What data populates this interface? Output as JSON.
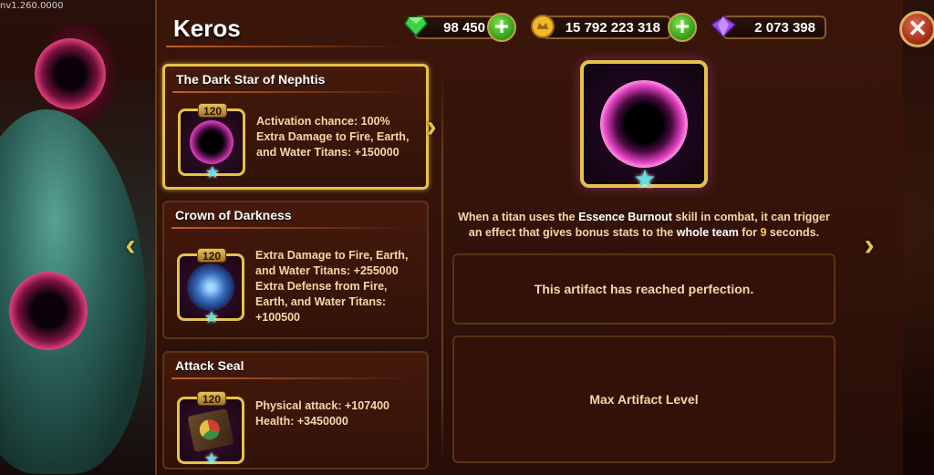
{
  "version": "nv1.260.0000",
  "hero_name": "Keros",
  "resources": {
    "emeralds": "98 450",
    "gold": "15 792 223 318",
    "crystals": "2 073 398"
  },
  "artifacts": [
    {
      "name": "The Dark Star of Nephtis",
      "level": "120",
      "description": "Activation chance: 100%\nExtra Damage to Fire, Earth,\nand Water Titans: +150000"
    },
    {
      "name": "Crown of Darkness",
      "level": "120",
      "description": "Extra Damage to Fire, Earth,\nand Water Titans: +255000\nExtra Defense from Fire,\nEarth, and Water Titans:\n+100500"
    },
    {
      "name": "Attack Seal",
      "level": "120",
      "description": "Physical attack: +107400\nHealth: +3450000"
    }
  ],
  "detail": {
    "desc_1": "When a titan uses the",
    "desc_hl1": "Essence Burnout",
    "desc_2": "skill in combat, it can trigger an effect that gives bonus stats to the",
    "desc_hl2": "whole team",
    "desc_3": "for",
    "desc_num": "9",
    "desc_4": "seconds.",
    "status": "This artifact has reached perfection.",
    "max_level": "Max Artifact Level"
  },
  "icons": {
    "emerald": "emerald-gem-icon",
    "gold": "gold-coin-icon",
    "crystal": "purple-crystal-icon",
    "plus": "plus-icon",
    "close": "close-icon",
    "star": "star-icon",
    "arrow_left": "chevron-left-icon",
    "arrow_right": "chevron-right-icon"
  },
  "colors": {
    "gold_border": "#e6c24a",
    "accent_text": "#f4d8a8",
    "highlight_number": "#ffd040"
  }
}
